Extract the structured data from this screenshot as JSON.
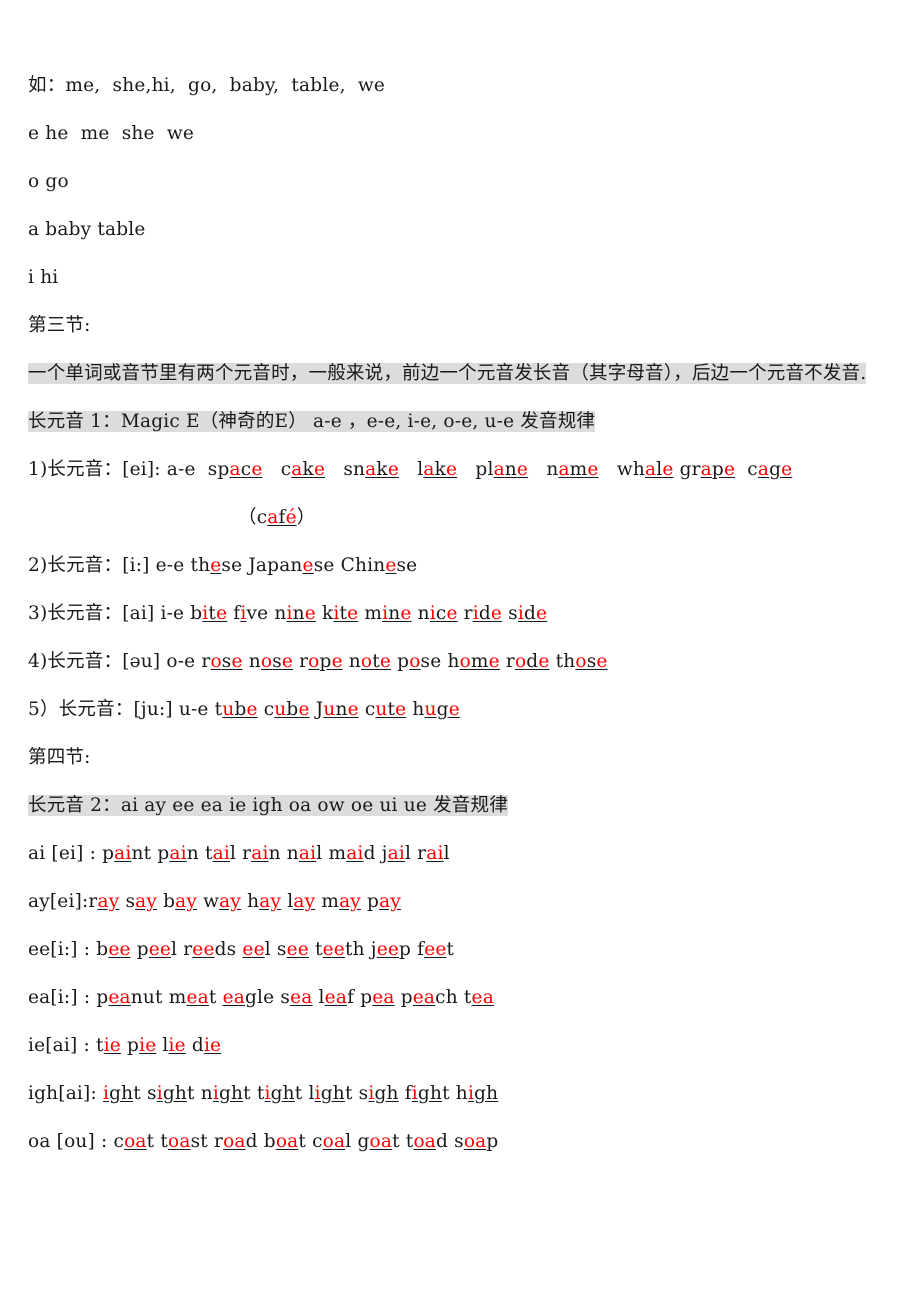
{
  "document": {
    "lines": [
      {
        "id": "examples-intro",
        "text": "如：me,  she,hi,  go,  baby,  table,  we"
      },
      {
        "id": "vowel-e-row",
        "text": "e he  me  she  we"
      },
      {
        "id": "vowel-o-row",
        "text": "o go"
      },
      {
        "id": "vowel-a-row",
        "text": "a baby table"
      },
      {
        "id": "vowel-i-row",
        "text": "i hi"
      },
      {
        "id": "section-three-heading",
        "text": "第三节:"
      }
    ],
    "rule_paragraph": {
      "id": "long-vowel-rule",
      "segments": [
        "一个单词或音节里有两个元音时，",
        "一般来说，前边一个元音发长音（其字母音），",
        "后边一个元音不发音."
      ],
      "full_text": "一个单词或音节里有两个元音时，　一般来说，前边一个元音发长音（其字母音），　后边一个元音不发音."
    },
    "long_vowel_1_heading": "长元音 1：Magic E（神奇的E） a-e ，e-e, i-e, o-e, u-e 发音规律",
    "long_vowel_1_rules": [
      {
        "label": "1)长元音：[ei]: a-e",
        "words": [
          "space",
          "cake",
          "snake",
          "lake",
          "plane",
          "name",
          "whale",
          "grape",
          "cage"
        ],
        "extra_line": "（café）"
      },
      {
        "label": "2)长元音：[i:] e-e",
        "words": [
          "these",
          "Japanese",
          "Chinese"
        ]
      },
      {
        "label": "3)长元音：[ai] i-e",
        "words": [
          "bite",
          "five",
          "nine",
          "kite",
          "mine",
          "nice",
          "ride",
          "side"
        ]
      },
      {
        "label": "4)长元音：[əu] o-e",
        "words": [
          "rose",
          "nose",
          "rope",
          "note",
          "pose",
          "home",
          "rode",
          "those"
        ]
      },
      {
        "label": "5）长元音：[ju:] u-e",
        "words": [
          "tube",
          "cube",
          "June",
          "cute",
          "huge"
        ]
      }
    ],
    "section_four_heading": "第四节:",
    "long_vowel_2_heading": "长元音 2：ai ay ee ea ie igh oa ow oe ui ue 发音规律",
    "long_vowel_2_rules": [
      {
        "label": "ai [ei] :",
        "words": [
          "paint",
          "pain",
          "tail",
          "rain",
          "nail",
          "maid",
          "jail",
          "rail"
        ]
      },
      {
        "label": "ay[ei]:",
        "words": [
          "ray",
          "say",
          "bay",
          "way",
          "hay",
          "lay",
          "may",
          "pay"
        ]
      },
      {
        "label": "ee[i:] :",
        "words": [
          "bee",
          "peel",
          "reeds",
          "eel",
          "see",
          "teeth",
          "jeep",
          "feet"
        ]
      },
      {
        "label": "ea[i:] :",
        "words": [
          "peanut",
          "meat",
          "eagle",
          "sea",
          "leaf",
          "pea",
          "peach",
          "tea"
        ]
      },
      {
        "label": "ie[ai] :",
        "words": [
          "tie",
          "pie",
          "lie",
          "die"
        ]
      },
      {
        "label": "igh[ai]:",
        "words": [
          "ight",
          "sight",
          "night",
          "tight",
          "light",
          "sigh",
          "fight",
          "high"
        ]
      },
      {
        "label": "oa [ou] :",
        "words": [
          "coat",
          "toast",
          "road",
          "boat",
          "coal",
          "goat",
          "toad",
          "soap"
        ]
      }
    ],
    "colors": {
      "highlight": "#dcdcdc",
      "accent_red": "#ff0000",
      "text": "#1a1a1a"
    }
  },
  "markup": {
    "line_1_rule": "1)长元音：[ei]: a-e  sp<u><r>a</r><k>c</k><r>e</r></u>   c<u><r>a</r><k>k</k><r>e</r></u>   sn<u><r>a</r><k>k</k><r>e</r></u>   l<u><r>a</r><k>k</k><r>e</r></u>   pl<u><r>a</r><k>n</k><r>e</r></u>   n<u><r>a</r><k>m</k><r>e</r></u>   wh<u><r>a</r><k>l</k><r>e</r></u> gr<u><r>a</r><k>p</k><r>e</r></u>  c<u><r>a</r><k>g</k><r>e</r></u>",
    "line_cafe": "（c<u><r>a</r><k>f</k><r>é</r></u>）",
    "line_2_rule": "2)长元音：[i:] e-e th<u><r>e</r></u>se Japan<u><r>e</r></u>se Chin<u><r>e</r></u>se",
    "line_3_rule": "3)长元音：[ai] i-e b<u><r>i</r><k>t</k><r>e</r></u> f<u><r>i</r></u>ve n<u><r>i</r><k>n</k><r>e</r></u> k<u><r>i</r><k>t</k><r>e</r></u> m<u><r>i</r><k>n</k><r>e</r></u> n<u><r>i</r><k>c</k><r>e</r></u> r<u><r>i</r><k>d</k><r>e</r></u> s<u><r>i</r><k>d</k><r>e</r></u>",
    "line_4_rule": "4)长元音：[əu] o-e r<u><r>o</r><k>s</k><r>e</r></u> n<u><r>o</r><k>s</k><r>e</r></u> r<u><r>o</r><k>p</k><r>e</r></u> n<u><r>o</r><k>t</k><r>e</r></u> p<u><r>o</r></u>se h<u><r>o</r><k>m</k><r>e</r></u> r<u><r>o</r><k>d</k><r>e</r></u> th<u><r>o</r><k>s</k><r>e</r></u>",
    "line_5_rule": "5）长元音：[ju:] u-e t<u><r>u</r><k>b</k><r>e</r></u> c<u><r>u</r><k>b</k><r>e</r></u> J<u><r>u</r><k>n</k><r>e</r></u> c<u><r>u</r><k>t</k><r>e</r></u> h<u><r>u</r><k>g</k><r>e</r></u>",
    "line_ai": "ai [ei] : p<u><r>ai</r></u>nt p<u><r>ai</r></u>n t<u><r>ai</r></u>l r<u><r>ai</r></u>n n<u><r>ai</r></u>l m<u><r>ai</r></u>d j<u><r>ai</r></u>l r<u><r>ai</r></u>l",
    "line_ay": "ay[ei]:r<u><r>ay</r></u> s<u><r>ay</r></u> b<u><r>ay</r></u> w<u><r>ay</r></u> h<u><r>ay</r></u> l<u><r>ay</r></u> m<u><r>ay</r></u> p<u><r>ay</r></u>",
    "line_ee": "ee[i:] : b<u><r>ee</r></u> p<u><r>ee</r></u>l r<u><r>ee</r></u>ds <u><r>ee</r></u>l s<u><r>ee</r></u> t<u><r>ee</r></u>th j<u><r>ee</r></u>p f<u><r>ee</r></u>t",
    "line_ea": "ea[i:] : p<u><r>ea</r></u>nut m<u><r>ea</r></u>t <u><r>ea</r></u>gle s<u><r>ea</r></u> l<u><r>ea</r></u>f p<u><r>ea</r></u> p<u><r>ea</r></u>ch t<u><r>ea</r></u>",
    "line_ie": "ie[ai] : t<u><r>ie</r></u> p<u><r>ie</r></u> l<u><r>ie</r></u> d<u><r>ie</r></u>",
    "line_igh": "igh[ai]: <u><r>i</r><k>gh</k></u>t s<u><r>i</r><k>gh</k></u>t n<u><r>i</r><k>gh</k></u>t t<u><r>i</r><k>gh</k></u>t l<u><r>i</r><k>gh</k></u>t s<u><r>i</r><k>gh</k></u> f<u><r>i</r><k>gh</k></u>t h<u><r>i</r><k>gh</k></u>",
    "line_oa": "oa [ou] : c<u><r>oa</r></u>t t<u><r>oa</r></u>st r<u><r>oa</r></u>d b<u><r>oa</r></u>t c<u><r>oa</r></u>l g<u><r>oa</r></u>t t<u><r>oa</r></u>d s<u><r>oa</r></u>p"
  }
}
